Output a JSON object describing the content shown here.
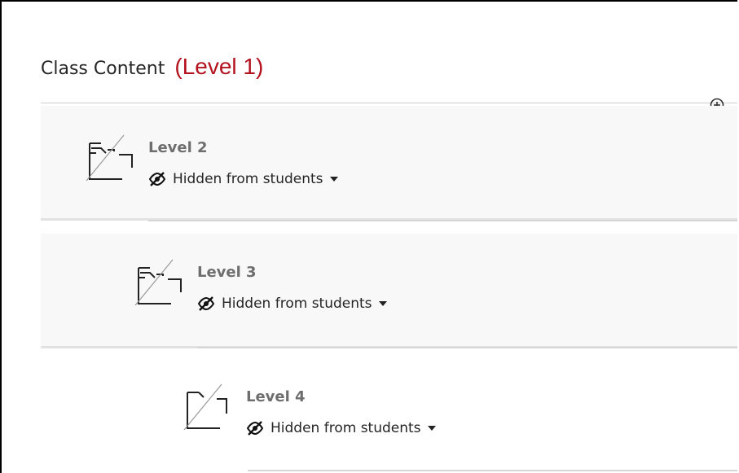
{
  "page": {
    "title": "Class Content",
    "level_tag": "(Level 1)"
  },
  "items": [
    {
      "title": "Level 2",
      "visibility": "Hidden from students"
    },
    {
      "title": "Level 3",
      "visibility": "Hidden from students"
    },
    {
      "title": "Level 4",
      "visibility": "Hidden from students"
    }
  ],
  "icons": {
    "add": "plus-circle-icon",
    "folder": "hidden-folder-icon",
    "visibility": "eye-slash-icon",
    "dropdown": "caret-down-icon"
  },
  "colors": {
    "level_tag": "#b3121f",
    "row_background": "#f8f8f8",
    "item_title": "#6e6e6e",
    "text": "#262626"
  }
}
